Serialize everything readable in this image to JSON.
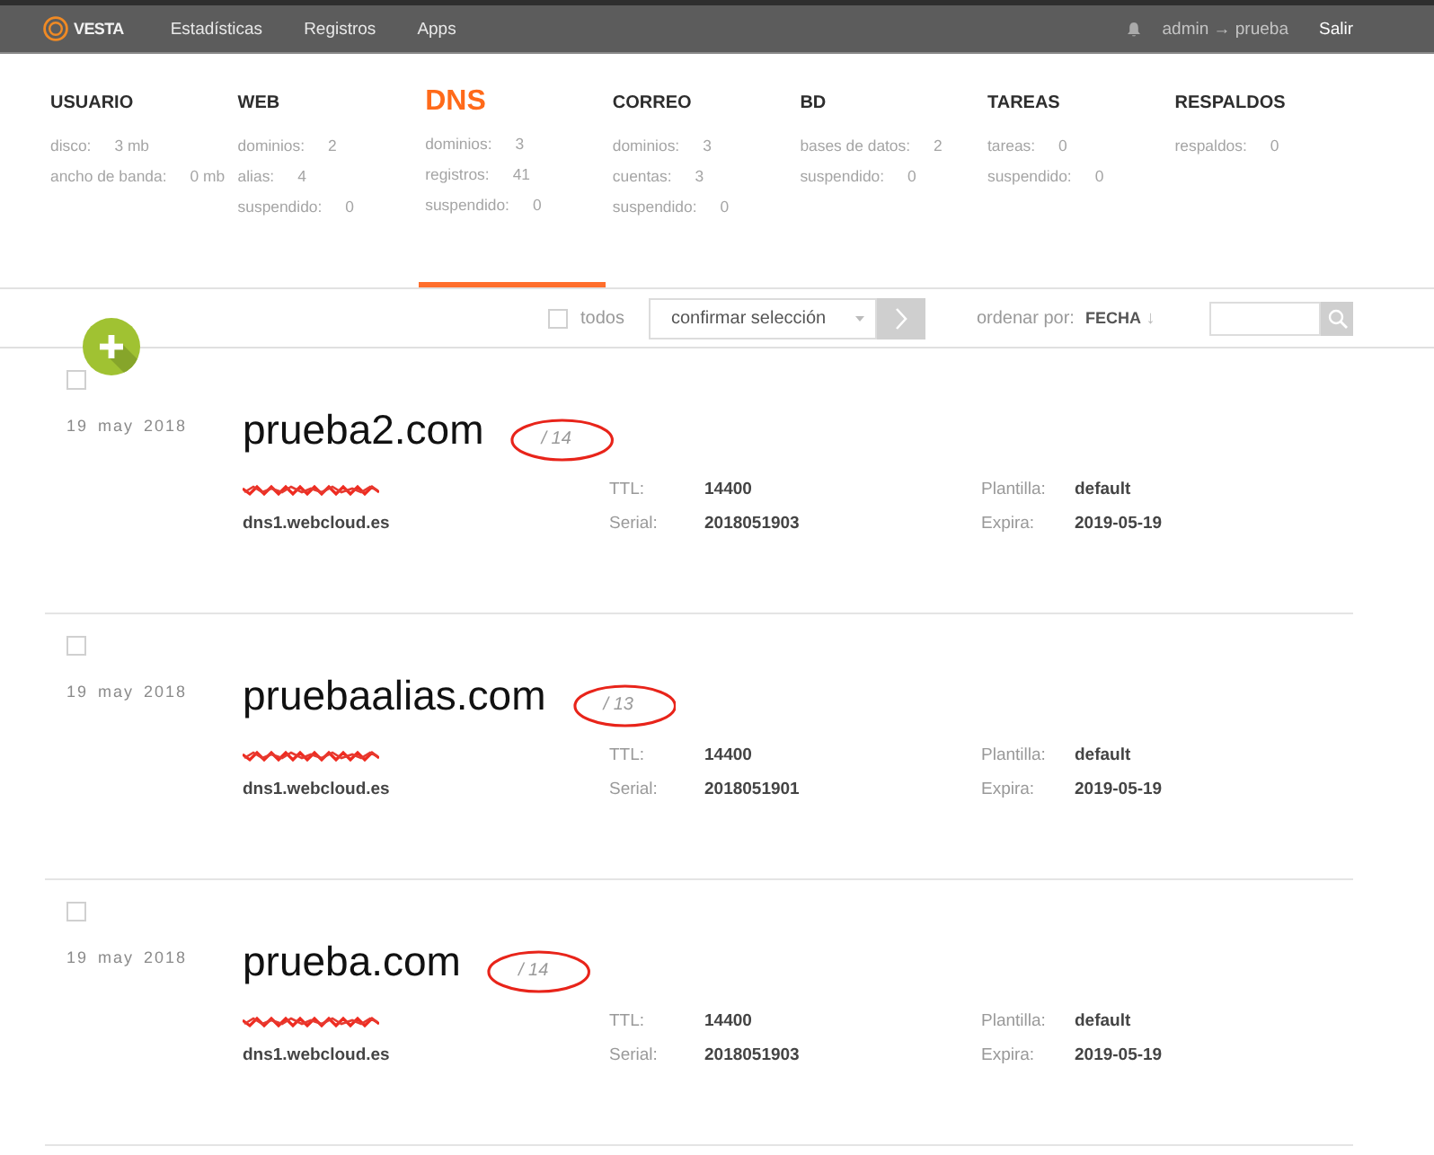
{
  "top_bar": {
    "logo": "VESTA",
    "menu": [
      {
        "label": "Estadísticas"
      },
      {
        "label": "Registros"
      },
      {
        "label": "Apps"
      }
    ],
    "user": "admin → prueba",
    "logout": "Salir"
  },
  "stats": [
    {
      "title": "USUARIO",
      "selected": false,
      "items": [
        {
          "label": "disco:",
          "value": "3 mb"
        },
        {
          "label": "ancho de banda:",
          "value": "0 mb"
        }
      ]
    },
    {
      "title": "WEB",
      "selected": false,
      "items": [
        {
          "label": "dominios:",
          "value": "2"
        },
        {
          "label": "alias:",
          "value": "4"
        },
        {
          "label": "suspendido:",
          "value": "0"
        }
      ]
    },
    {
      "title": "DNS",
      "selected": true,
      "items": [
        {
          "label": "dominios:",
          "value": "3"
        },
        {
          "label": "registros:",
          "value": "41"
        },
        {
          "label": "suspendido:",
          "value": "0"
        }
      ]
    },
    {
      "title": "CORREO",
      "selected": false,
      "items": [
        {
          "label": "dominios:",
          "value": "3"
        },
        {
          "label": "cuentas:",
          "value": "3"
        },
        {
          "label": "suspendido:",
          "value": "0"
        }
      ]
    },
    {
      "title": "BD",
      "selected": false,
      "items": [
        {
          "label": "bases de datos:",
          "value": "2"
        },
        {
          "label": "suspendido:",
          "value": "0"
        }
      ]
    },
    {
      "title": "TAREAS",
      "selected": false,
      "items": [
        {
          "label": "tareas:",
          "value": "0"
        },
        {
          "label": "suspendido:",
          "value": "0"
        }
      ]
    },
    {
      "title": "RESPALDOS",
      "selected": false,
      "items": [
        {
          "label": "respaldos:",
          "value": "0"
        }
      ]
    }
  ],
  "toolbar": {
    "select_all": {
      "label": "todos",
      "checked": false
    },
    "bulk_action": "confirmar selección",
    "sort_label": "ordenar por:",
    "sort_value": "**FECHA** ↓"
  },
  "rows": [
    {
      "checked": false,
      "date": "19 may 2018",
      "domain": "prueba2.com",
      "record_count": "/ 14",
      "circled": true,
      "host_redacted": true,
      "nameserver": "dns1.webcloud.es",
      "fields": [
        {
          "label": "TTL:",
          "value": "14400"
        },
        {
          "label": "Plantilla:",
          "value": "default"
        },
        {
          "label": "Serial:",
          "value": "2018051903"
        },
        {
          "label": "Expira:",
          "value": "2019-05-19"
        }
      ]
    },
    {
      "checked": false,
      "date": "19 may 2018",
      "domain": "pruebaalias.com",
      "record_count": "/ 13",
      "circled": true,
      "host_redacted": true,
      "nameserver": "dns1.webcloud.es",
      "fields": [
        {
          "label": "TTL:",
          "value": "14400"
        },
        {
          "label": "Plantilla:",
          "value": "default"
        },
        {
          "label": "Serial:",
          "value": "2018051901"
        },
        {
          "label": "Expira:",
          "value": "2019-05-19"
        }
      ]
    },
    {
      "checked": false,
      "date": "19 may 2018",
      "domain": "prueba.com",
      "record_count": "/ 14",
      "circled": true,
      "host_redacted": true,
      "nameserver": "dns1.webcloud.es",
      "fields": [
        {
          "label": "TTL:",
          "value": "14400"
        },
        {
          "label": "Plantilla:",
          "value": "default"
        },
        {
          "label": "Serial:",
          "value": "2018051903"
        },
        {
          "label": "Expira:",
          "value": "2019-05-19"
        }
      ]
    }
  ]
}
